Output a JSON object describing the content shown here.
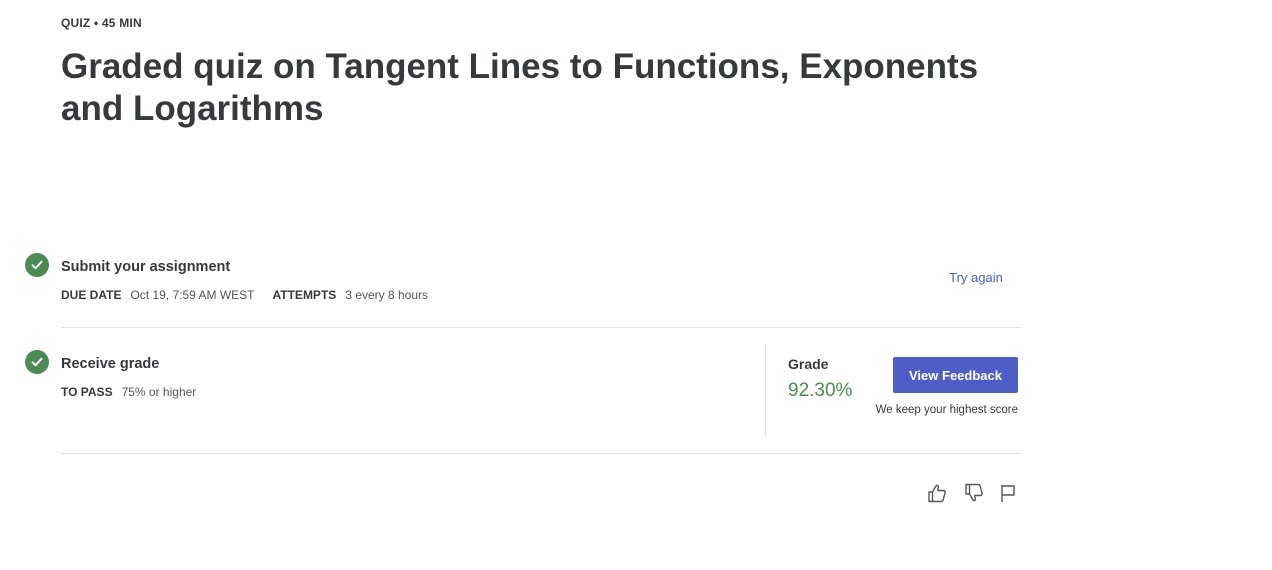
{
  "header": {
    "eyebrow": "QUIZ • 45 MIN",
    "title": "Graded quiz on Tangent Lines to Functions, Exponents and Logarithms"
  },
  "submit_step": {
    "heading": "Submit your assignment",
    "due_date_label": "DUE DATE",
    "due_date_value": "Oct 19, 7:59 AM WEST",
    "attempts_label": "ATTEMPTS",
    "attempts_value": "3 every 8 hours",
    "action_label": "Try again",
    "status_icon": "check-circle-icon"
  },
  "grade_step": {
    "heading": "Receive grade",
    "to_pass_label": "TO PASS",
    "to_pass_value": "75% or higher",
    "grade_label": "Grade",
    "grade_value": "92.30%",
    "button_label": "View Feedback",
    "note": "We keep your highest score",
    "status_icon": "check-circle-icon"
  },
  "footer_actions": {
    "icons": [
      "thumbs-up-icon",
      "thumbs-down-icon",
      "flag-icon"
    ]
  },
  "colors": {
    "accent": "#4f5ec7",
    "success": "#4d8a52",
    "text": "#373a3c",
    "divider": "#e3e3e3"
  }
}
